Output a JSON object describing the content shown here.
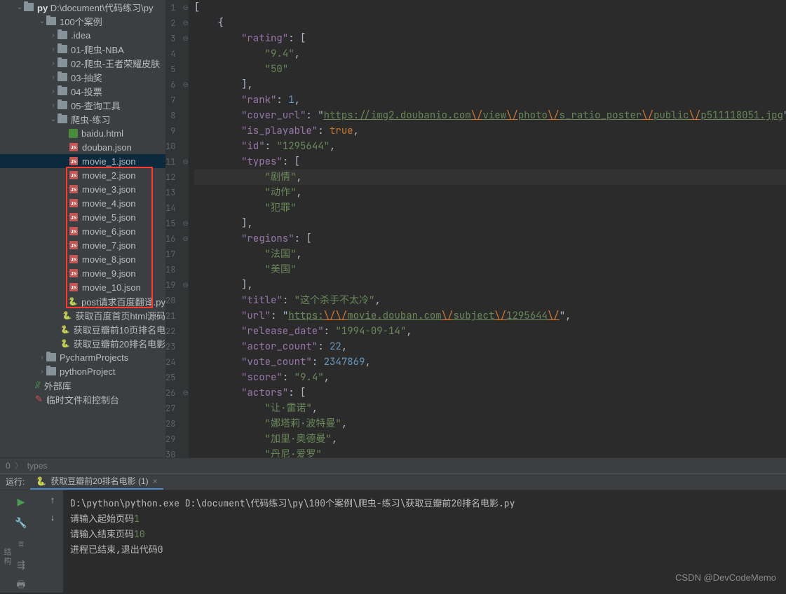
{
  "sidebar": {
    "root": {
      "name": "py",
      "path": "D:\\document\\代码练习\\py"
    },
    "items": [
      {
        "label": "100个案例",
        "depth": 2,
        "type": "folder",
        "open": true
      },
      {
        "label": ".idea",
        "depth": 3,
        "type": "folder",
        "open": false
      },
      {
        "label": "01-爬虫-NBA",
        "depth": 3,
        "type": "folder",
        "open": false
      },
      {
        "label": "02-爬虫-王者荣耀皮肤",
        "depth": 3,
        "type": "folder",
        "open": false
      },
      {
        "label": "03-抽奖",
        "depth": 3,
        "type": "folder",
        "open": false
      },
      {
        "label": "04-投票",
        "depth": 3,
        "type": "folder",
        "open": false
      },
      {
        "label": "05-查询工具",
        "depth": 3,
        "type": "folder",
        "open": false
      },
      {
        "label": "爬虫-练习",
        "depth": 3,
        "type": "folder",
        "open": true
      },
      {
        "label": "baidu.html",
        "depth": 4,
        "type": "html"
      },
      {
        "label": "douban.json",
        "depth": 4,
        "type": "json"
      },
      {
        "label": "movie_1.json",
        "depth": 4,
        "type": "json",
        "selected": true,
        "boxed": true
      },
      {
        "label": "movie_2.json",
        "depth": 4,
        "type": "json",
        "boxed": true
      },
      {
        "label": "movie_3.json",
        "depth": 4,
        "type": "json",
        "boxed": true
      },
      {
        "label": "movie_4.json",
        "depth": 4,
        "type": "json",
        "boxed": true
      },
      {
        "label": "movie_5.json",
        "depth": 4,
        "type": "json",
        "boxed": true
      },
      {
        "label": "movie_6.json",
        "depth": 4,
        "type": "json",
        "boxed": true
      },
      {
        "label": "movie_7.json",
        "depth": 4,
        "type": "json",
        "boxed": true
      },
      {
        "label": "movie_8.json",
        "depth": 4,
        "type": "json",
        "boxed": true
      },
      {
        "label": "movie_9.json",
        "depth": 4,
        "type": "json",
        "boxed": true
      },
      {
        "label": "movie_10.json",
        "depth": 4,
        "type": "json",
        "boxed": true
      },
      {
        "label": "post请求百度翻译.py",
        "depth": 4,
        "type": "py"
      },
      {
        "label": "获取百度首页html源码",
        "depth": 4,
        "type": "py"
      },
      {
        "label": "获取豆瓣前10页排名电",
        "depth": 4,
        "type": "py"
      },
      {
        "label": "获取豆瓣前20排名电影",
        "depth": 4,
        "type": "py"
      },
      {
        "label": "PycharmProjects",
        "depth": 2,
        "type": "folder",
        "open": false
      },
      {
        "label": "pythonProject",
        "depth": 2,
        "type": "folder",
        "open": false
      },
      {
        "label": "外部库",
        "depth": 1,
        "type": "lib"
      },
      {
        "label": "临时文件和控制台",
        "depth": 1,
        "type": "scratch"
      }
    ]
  },
  "editor": {
    "lines": [
      {
        "n": 1,
        "t": "[",
        "fold": "⊖"
      },
      {
        "n": 2,
        "t": "    {",
        "fold": "⊖"
      },
      {
        "n": 3,
        "t": "        \"rating\": [",
        "fold": "⊖"
      },
      {
        "n": 4,
        "t": "            \"9.4\","
      },
      {
        "n": 5,
        "t": "            \"50\""
      },
      {
        "n": 6,
        "t": "        ],",
        "fold": "⊖"
      },
      {
        "n": 7,
        "t": "        \"rank\": 1,"
      },
      {
        "n": 8,
        "t": "        \"cover_url\": \"https://img2.doubanio.com\\/view\\/photo\\/s_ratio_poster\\/public\\/p511118051.jpg\","
      },
      {
        "n": 9,
        "t": "        \"is_playable\": true,"
      },
      {
        "n": 10,
        "t": "        \"id\": \"1295644\","
      },
      {
        "n": 11,
        "t": "        \"types\": [",
        "fold": "⊖"
      },
      {
        "n": 12,
        "t": "            \"剧情\",",
        "hl": true
      },
      {
        "n": 13,
        "t": "            \"动作\","
      },
      {
        "n": 14,
        "t": "            \"犯罪\""
      },
      {
        "n": 15,
        "t": "        ],",
        "fold": "⊖"
      },
      {
        "n": 16,
        "t": "        \"regions\": [",
        "fold": "⊖"
      },
      {
        "n": 17,
        "t": "            \"法国\","
      },
      {
        "n": 18,
        "t": "            \"美国\""
      },
      {
        "n": 19,
        "t": "        ],",
        "fold": "⊖"
      },
      {
        "n": 20,
        "t": "        \"title\": \"这个杀手不太冷\","
      },
      {
        "n": 21,
        "t": "        \"url\": \"https:\\/\\/movie.douban.com\\/subject\\/1295644\\/\","
      },
      {
        "n": 22,
        "t": "        \"release_date\": \"1994-09-14\","
      },
      {
        "n": 23,
        "t": "        \"actor_count\": 22,"
      },
      {
        "n": 24,
        "t": "        \"vote_count\": 2347869,"
      },
      {
        "n": 25,
        "t": "        \"score\": \"9.4\","
      },
      {
        "n": 26,
        "t": "        \"actors\": [",
        "fold": "⊖"
      },
      {
        "n": 27,
        "t": "            \"让·雷诺\","
      },
      {
        "n": 28,
        "t": "            \"娜塔莉·波特曼\","
      },
      {
        "n": 29,
        "t": "            \"加里·奥德曼\","
      },
      {
        "n": 30,
        "t": "            \"丹尼·爱罗\""
      }
    ]
  },
  "breadcrumb": {
    "items": [
      "0",
      "types"
    ]
  },
  "run": {
    "label": "运行:",
    "tab": "获取豆瓣前20排名电影 (1)",
    "lines": [
      "D:\\python\\python.exe D:\\document\\代码练习\\py\\100个案例\\爬虫-练习\\获取豆瓣前20排名电影.py",
      "请输入起始页码1",
      "请输入结束页码10",
      "",
      "进程已结束,退出代码0"
    ],
    "inputs": [
      "1",
      "10"
    ]
  },
  "watermark": "CSDN @DevCodeMemo",
  "side_text": "结构"
}
